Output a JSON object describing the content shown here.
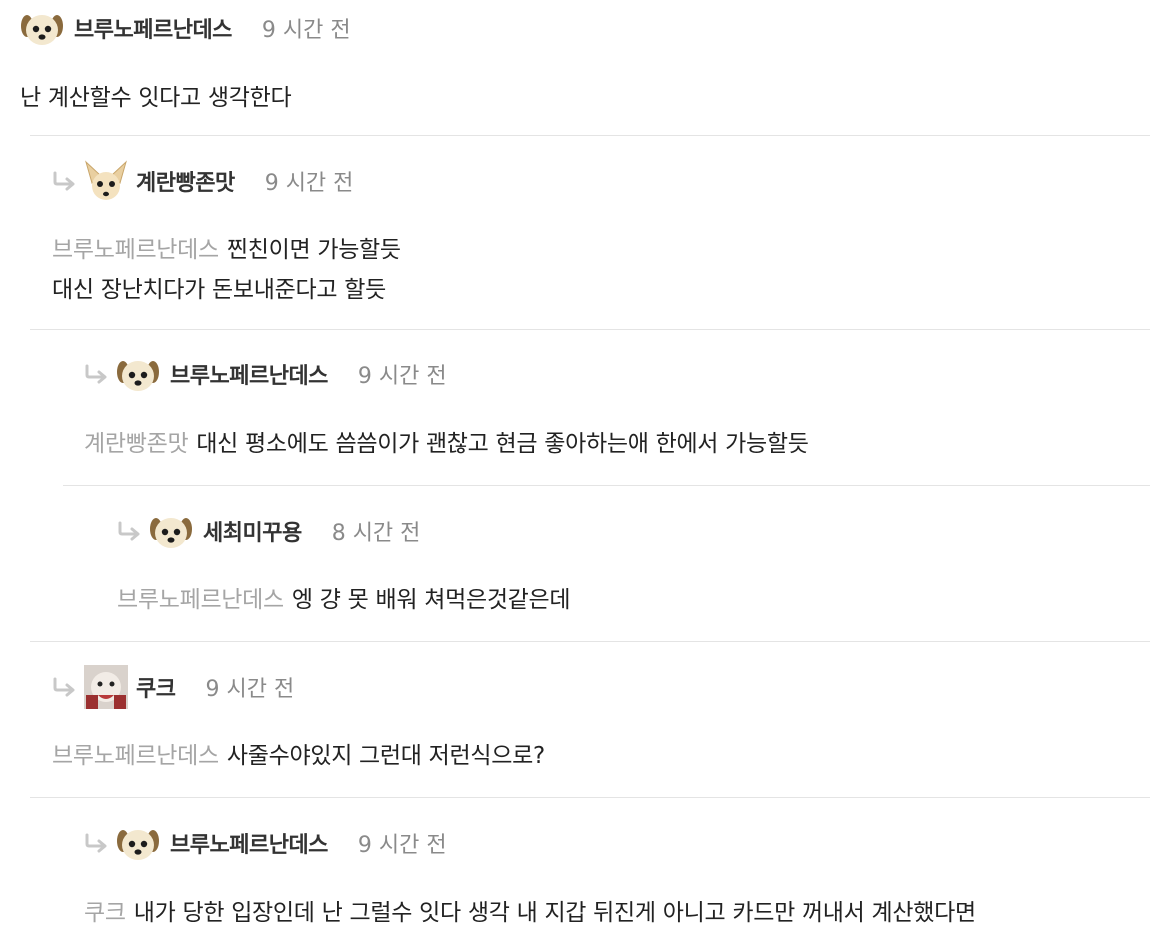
{
  "comments": [
    {
      "author": "브루노페르난데스",
      "time": "9 시간 전",
      "mention": "",
      "lines": [
        "난 계산할수 잇다고 생각한다"
      ]
    },
    {
      "author": "계란빵존맛",
      "time": "9 시간 전",
      "mention": "브루노페르난데스",
      "lines": [
        "찐친이면 가능할듯",
        "대신 장난치다가 돈보내준다고 할듯"
      ]
    },
    {
      "author": "브루노페르난데스",
      "time": "9 시간 전",
      "mention": "계란빵존맛",
      "lines": [
        "대신 평소에도 씀씀이가 괜찮고 현금 좋아하는애 한에서 가능할듯"
      ]
    },
    {
      "author": "세최미꾸용",
      "time": "8 시간 전",
      "mention": "브루노페르난데스",
      "lines": [
        "엥 걍 못 배워 쳐먹은것같은데"
      ]
    },
    {
      "author": "쿠크",
      "time": "9 시간 전",
      "mention": "브루노페르난데스",
      "lines": [
        "사줄수야있지 그런대 저런식으로?"
      ]
    },
    {
      "author": "브루노페르난데스",
      "time": "9 시간 전",
      "mention": "쿠크",
      "lines": [
        "내가 당한 입장인데 난 그럴수 잇다 생각 내 지갑 뒤진게 아니고 카드만 꺼내서 계산했다면"
      ]
    }
  ],
  "icons": {
    "reply": "reply-arrow-icon",
    "avatar_dog": "puppy-avatar-icon",
    "avatar_chihuahua": "chihuahua-avatar-icon",
    "avatar_photo": "photo-avatar-icon"
  },
  "colors": {
    "author": "#333333",
    "time": "#8a8a8a",
    "mention": "#a5a5a5",
    "divider": "#e4e4e4",
    "reply_arrow": "#c8c8c8"
  }
}
